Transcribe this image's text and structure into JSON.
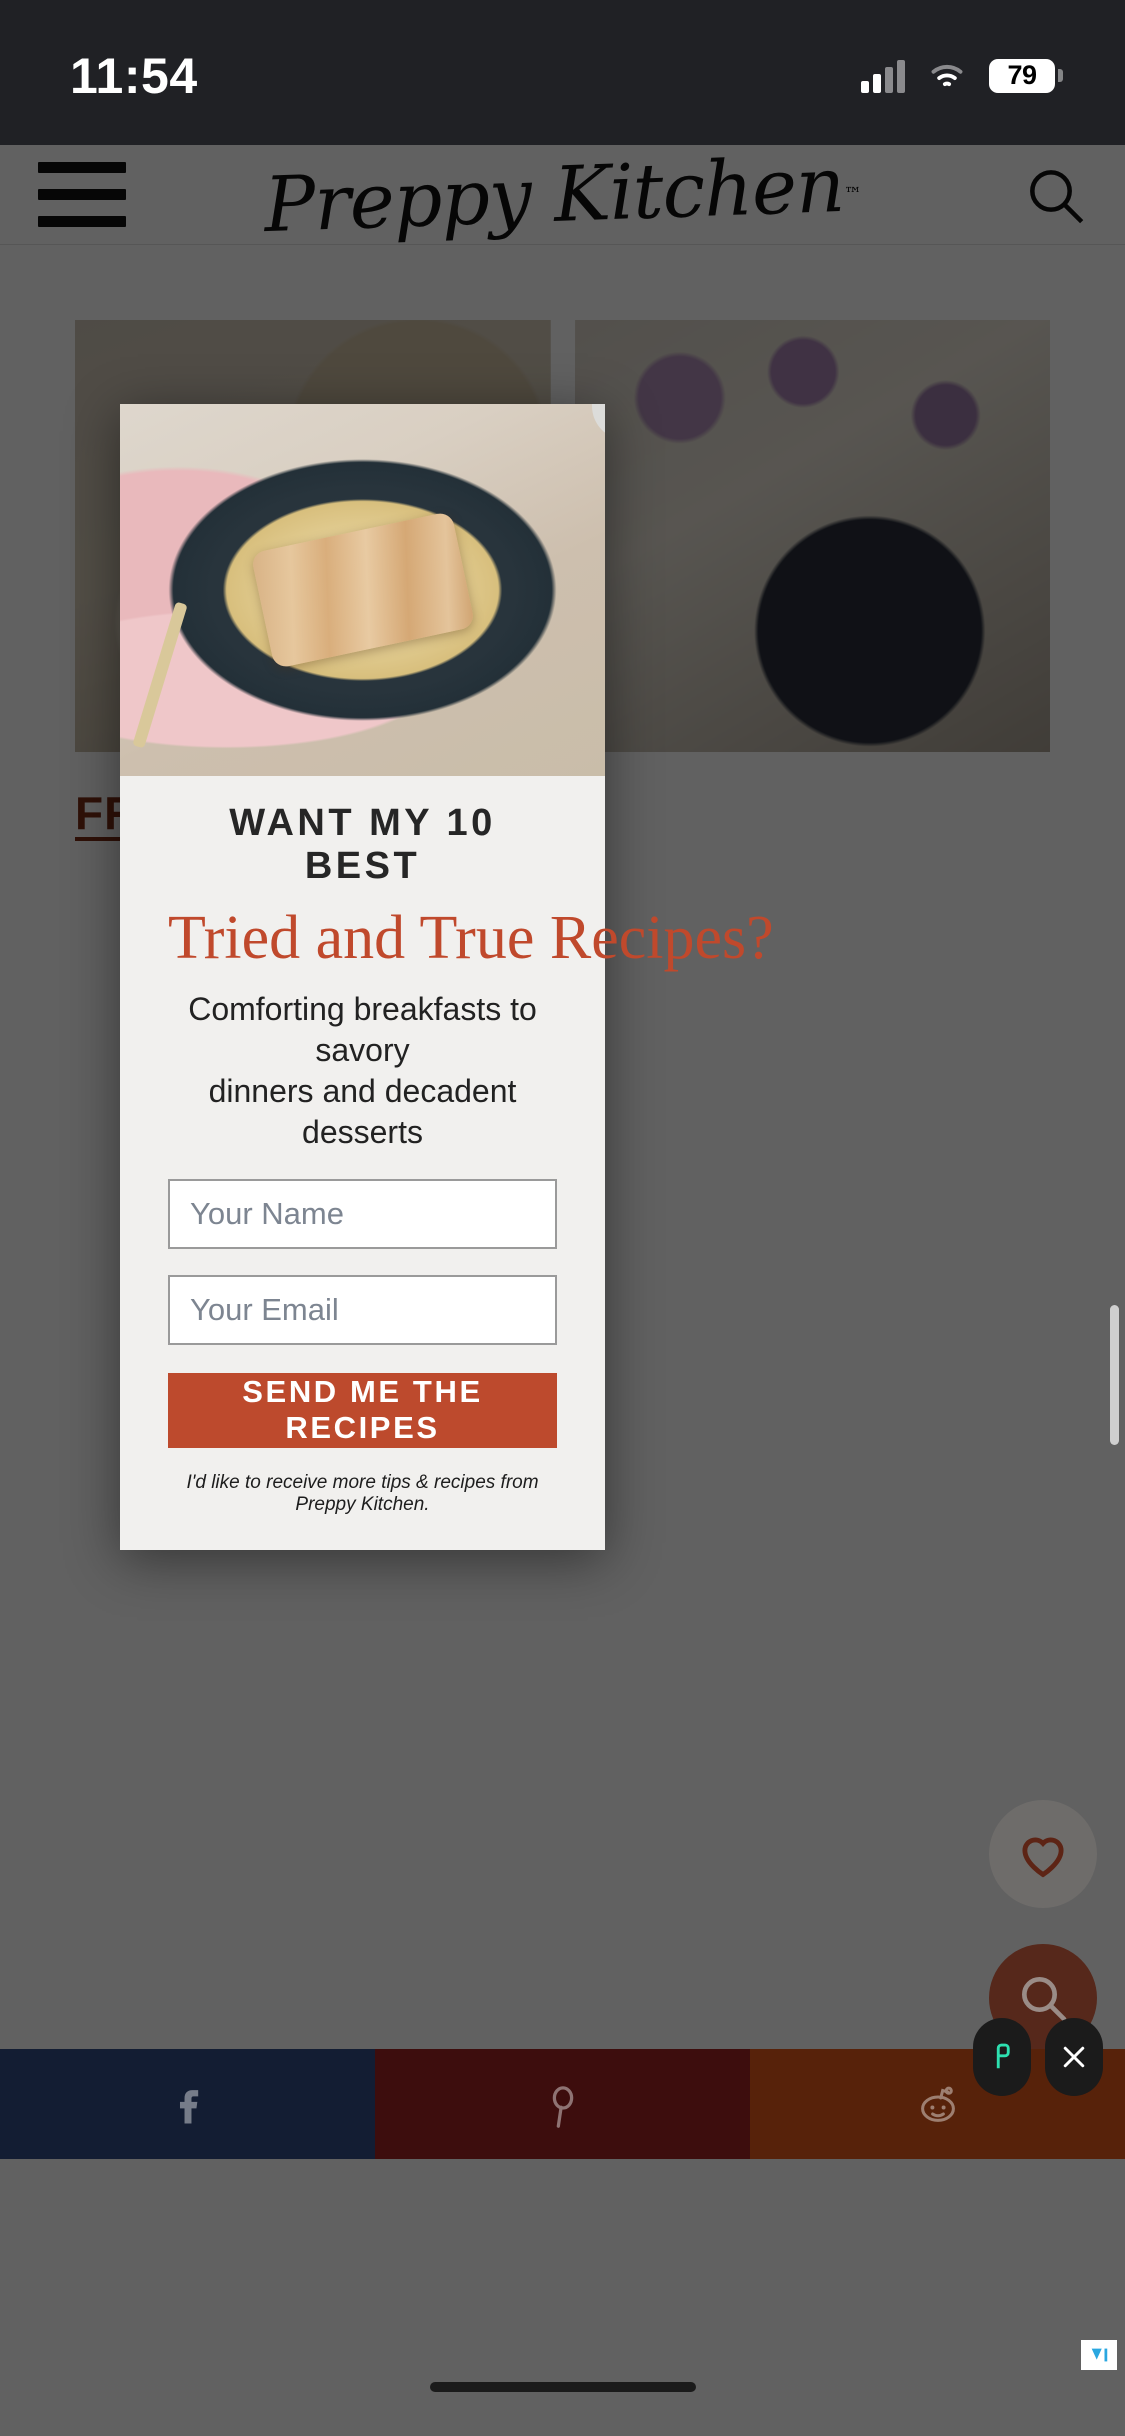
{
  "status_bar": {
    "time": "11:54",
    "battery_level": "79",
    "cellular_icon": "cellular-signal-icon",
    "wifi_icon": "wifi-icon",
    "battery_icon": "battery-icon"
  },
  "site_header": {
    "menu_icon": "hamburger-menu-icon",
    "logo_text": "Preppy Kitchen",
    "logo_tm": "™",
    "search_icon": "search-icon"
  },
  "page_content": {
    "cards": [
      {
        "title": "FREE",
        "image_alt": "sliced-bread-photo"
      },
      {
        "title": "",
        "image_alt": "dessert-with-flowers-photo"
      }
    ]
  },
  "modal": {
    "close_icon": "close-icon",
    "hero_image_alt": "chicken-fettuccine-alfredo-photo",
    "kicker": "WANT MY 10 BEST",
    "headline": "Tried and True Recipes?",
    "subcopy_line1": "Comforting breakfasts to savory",
    "subcopy_line2": "dinners and decadent desserts",
    "name_field": {
      "value": "",
      "placeholder": "Your Name"
    },
    "email_field": {
      "value": "",
      "placeholder": "Your Email"
    },
    "submit_label": "SEND ME THE RECIPES",
    "fineprint": "I'd like to receive more tips & recipes from Preppy Kitchen.",
    "accent_color": "#bd4a2d",
    "headline_color": "#c0492c",
    "background_color": "#f1f0ee"
  },
  "floating_buttons": {
    "favorite_icon": "heart-icon",
    "search_icon": "search-icon",
    "favorite_bg": "#6e6c6a",
    "search_bg": "#56281b"
  },
  "share_bar": {
    "items": [
      {
        "network": "facebook",
        "icon": "facebook-icon",
        "color": "#131d33"
      },
      {
        "network": "pinterest",
        "icon": "pinterest-icon",
        "color": "#3d0d0d"
      },
      {
        "network": "reddit",
        "icon": "reddit-icon",
        "color": "#57220a"
      }
    ],
    "pills": [
      {
        "icon": "share-toggle-icon",
        "color": "#2de0b0"
      },
      {
        "icon": "close-icon",
        "color": "#ffffff"
      }
    ]
  },
  "system": {
    "home_indicator": "home-indicator",
    "adchoices_icon": "adchoices-icon"
  }
}
